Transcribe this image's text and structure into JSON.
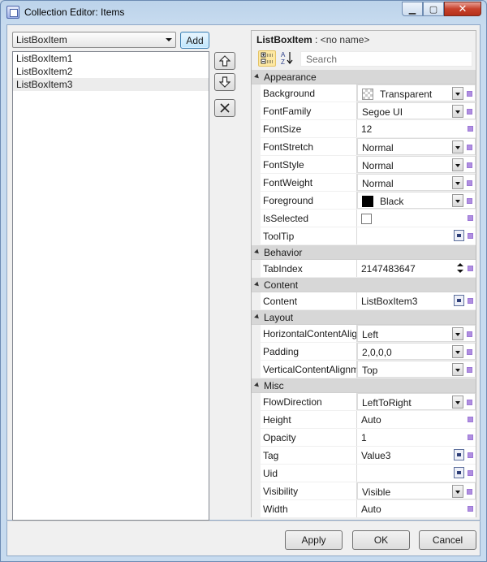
{
  "window": {
    "title": "Collection Editor: Items"
  },
  "left": {
    "type_combo": "ListBoxItem",
    "add_label": "Add",
    "items": [
      "ListBoxItem1",
      "ListBoxItem2",
      "ListBoxItem3"
    ],
    "selected_index": 2,
    "buttons": [
      "up-arrow-icon",
      "down-arrow-icon",
      "delete-icon"
    ]
  },
  "property_grid": {
    "header_type": "ListBoxItem",
    "header_sep": ":",
    "header_name": "<no name>",
    "search_placeholder": "Search",
    "categories": [
      {
        "name": "Appearance",
        "rows": [
          {
            "name": "Background",
            "value": "Transparent",
            "editor": "dropdown",
            "swatch": "transparent"
          },
          {
            "name": "FontFamily",
            "value": "Segoe UI",
            "editor": "dropdown"
          },
          {
            "name": "FontSize",
            "value": "12",
            "editor": "text"
          },
          {
            "name": "FontStretch",
            "value": "Normal",
            "editor": "dropdown"
          },
          {
            "name": "FontStyle",
            "value": "Normal",
            "editor": "dropdown"
          },
          {
            "name": "FontWeight",
            "value": "Normal",
            "editor": "dropdown"
          },
          {
            "name": "Foreground",
            "value": "Black",
            "editor": "dropdown",
            "swatch": "black"
          },
          {
            "name": "IsSelected",
            "value": "",
            "editor": "checkbox"
          },
          {
            "name": "ToolTip",
            "value": "",
            "editor": "dialog"
          }
        ]
      },
      {
        "name": "Behavior",
        "rows": [
          {
            "name": "TabIndex",
            "value": "2147483647",
            "editor": "spinner"
          }
        ]
      },
      {
        "name": "Content",
        "rows": [
          {
            "name": "Content",
            "value": "ListBoxItem3",
            "editor": "dialog"
          }
        ]
      },
      {
        "name": "Layout",
        "rows": [
          {
            "name": "HorizontalContentAlig",
            "value": "Left",
            "editor": "dropdown"
          },
          {
            "name": "Padding",
            "value": "2,0,0,0",
            "editor": "dropdown"
          },
          {
            "name": "VerticalContentAlignm",
            "value": "Top",
            "editor": "dropdown"
          }
        ]
      },
      {
        "name": "Misc",
        "rows": [
          {
            "name": "FlowDirection",
            "value": "LeftToRight",
            "editor": "dropdown"
          },
          {
            "name": "Height",
            "value": "Auto",
            "editor": "text"
          },
          {
            "name": "Opacity",
            "value": "1",
            "editor": "text"
          },
          {
            "name": "Tag",
            "value": "Value3",
            "editor": "dialog"
          },
          {
            "name": "Uid",
            "value": "",
            "editor": "dialog"
          },
          {
            "name": "Visibility",
            "value": "Visible",
            "editor": "dropdown"
          },
          {
            "name": "Width",
            "value": "Auto",
            "editor": "text"
          }
        ]
      }
    ]
  },
  "footer": {
    "apply": "Apply",
    "ok": "OK",
    "cancel": "Cancel"
  }
}
